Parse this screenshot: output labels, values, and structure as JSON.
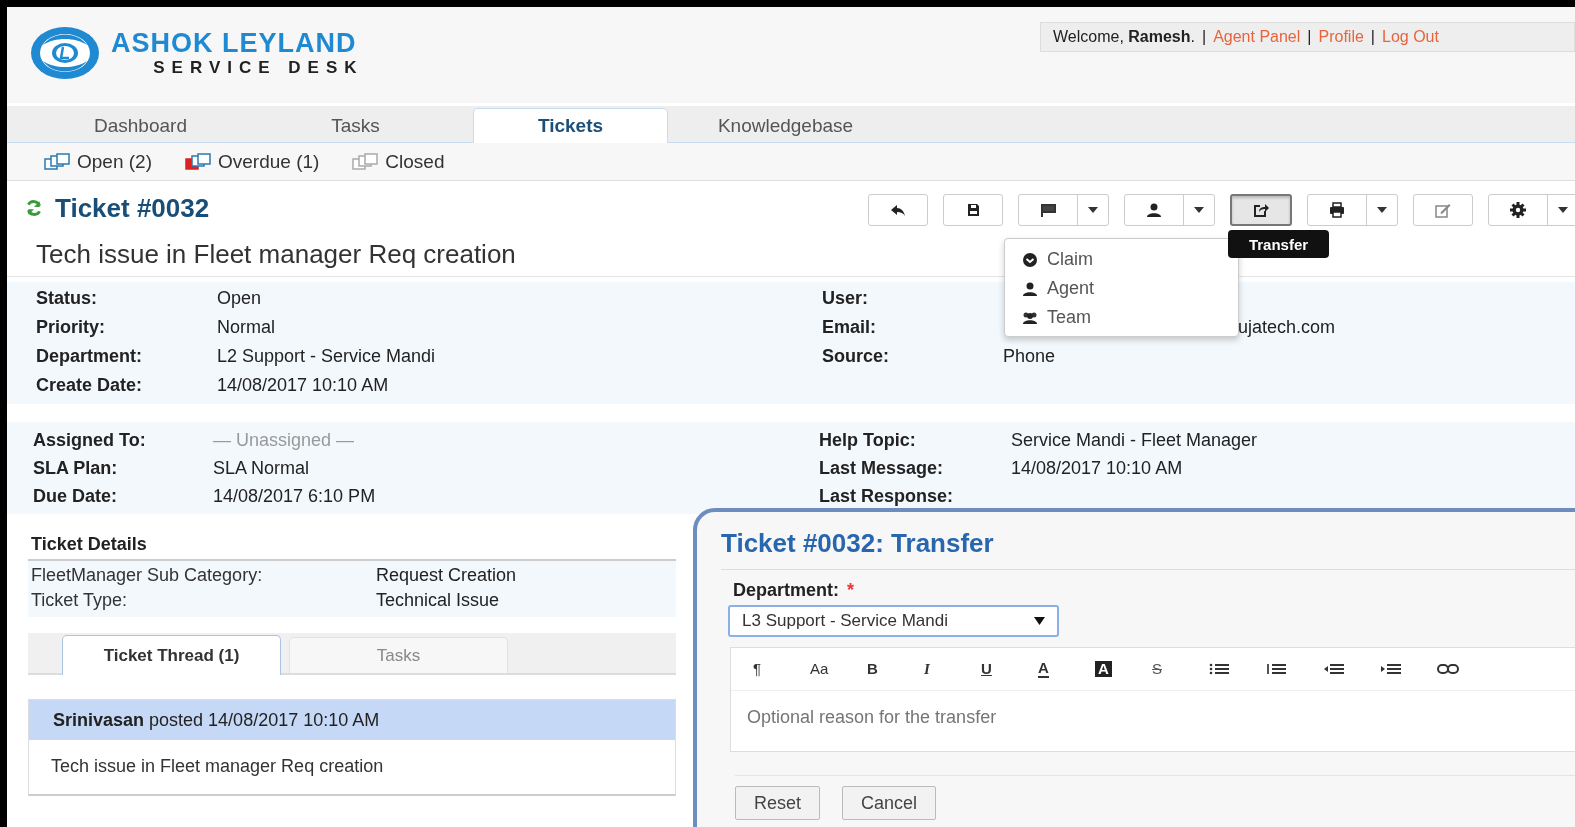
{
  "header": {
    "logo_name": "ASHOK LEYLAND",
    "logo_subtitle": "SERVICE DESK",
    "welcome": "Welcome, **Ramesh**.",
    "separator": "|",
    "links": [
      "Agent Panel",
      "Profile",
      "Log Out"
    ]
  },
  "nav_tabs": [
    {
      "label": "Dashboard",
      "selected": false
    },
    {
      "label": "Tasks",
      "selected": false
    },
    {
      "label": "Tickets",
      "selected": true
    },
    {
      "label": "Knowledgebase",
      "selected": false
    }
  ],
  "sub_nav": [
    {
      "label": "Open (2)",
      "kind": "open"
    },
    {
      "label": "Overdue (1)",
      "kind": "overdue"
    },
    {
      "label": "Closed",
      "kind": "closed"
    }
  ],
  "ticket": {
    "title": "Ticket #0032",
    "subject": "Tech issue in Fleet manager Req creation"
  },
  "toolbar": [
    {
      "kind": "reply",
      "dropdown": false,
      "pressed": false
    },
    {
      "kind": "save",
      "dropdown": false,
      "pressed": false
    },
    {
      "kind": "flag",
      "dropdown": true,
      "pressed": false
    },
    {
      "kind": "assign",
      "dropdown": true,
      "pressed": false
    },
    {
      "kind": "transfer",
      "dropdown": false,
      "pressed": true
    },
    {
      "kind": "print",
      "dropdown": true,
      "pressed": false
    },
    {
      "kind": "edit",
      "dropdown": false,
      "pressed": false
    },
    {
      "kind": "settings",
      "dropdown": true,
      "pressed": false
    }
  ],
  "tooltip": "Transfer",
  "assign_menu": [
    {
      "kind": "claim",
      "label": "Claim"
    },
    {
      "kind": "agent",
      "label": "Agent"
    },
    {
      "kind": "team",
      "label": "Team"
    }
  ],
  "info_left": [
    {
      "label": "Status:",
      "value": "Open",
      "muted": false
    },
    {
      "label": "Priority:",
      "value": "Normal",
      "muted": false
    },
    {
      "label": "Department:",
      "value": "L2 Support - Service Mandi",
      "muted": false
    },
    {
      "label": "Create Date:",
      "value": "14/08/2017 10:10 AM",
      "muted": false
    }
  ],
  "info_right": [
    {
      "label": "User:"
    },
    {
      "label": "Email:",
      "value": "ujatech.com"
    },
    {
      "label": "Source:",
      "value": "Phone"
    }
  ],
  "assign_left": [
    {
      "label": "Assigned To:",
      "value": "— Unassigned —",
      "muted": true
    },
    {
      "label": "SLA Plan:",
      "value": "SLA Normal",
      "muted": false
    },
    {
      "label": "Due Date:",
      "value": "14/08/2017 6:10 PM",
      "muted": false
    }
  ],
  "assign_right": [
    {
      "label": "Help Topic:",
      "value": "Service Mandi - Fleet Manager"
    },
    {
      "label": "Last Message:",
      "value": "14/08/2017 10:10 AM"
    },
    {
      "label": "Last Response:"
    }
  ],
  "details": {
    "title": "Ticket Details",
    "rows": [
      {
        "label": "FleetManager Sub Category:",
        "value": "Request Creation"
      },
      {
        "label": "Ticket Type:",
        "value": "Technical Issue"
      }
    ]
  },
  "thread_tabs": [
    {
      "label": "Ticket Thread (1)",
      "selected": true
    },
    {
      "label": "Tasks",
      "selected": false
    }
  ],
  "thread": [
    {
      "header": "**Srinivasan** posted 14/08/2017 10:10 AM",
      "body": "Tech issue in Fleet manager Req creation"
    }
  ],
  "dialog": {
    "title": "Ticket #0032: Transfer",
    "field_label": "Department:",
    "required": "*",
    "department": "L3 Support - Service Mandi",
    "editor_tools": [
      {
        "kind": "paragraph",
        "label": "¶"
      },
      {
        "kind": "font",
        "label": "Aa"
      },
      {
        "kind": "bold",
        "label": "B"
      },
      {
        "kind": "italic",
        "label": "I"
      },
      {
        "kind": "underline",
        "label": "U"
      },
      {
        "kind": "color",
        "label": "A"
      },
      {
        "kind": "highlight",
        "label": "A"
      },
      {
        "kind": "strike",
        "label": "S"
      },
      {
        "kind": "list-ul"
      },
      {
        "kind": "list-ol"
      },
      {
        "kind": "outdent"
      },
      {
        "kind": "indent"
      },
      {
        "kind": "link"
      }
    ],
    "placeholder": "Optional reason for the transfer",
    "buttons": [
      "Reset",
      "Cancel"
    ]
  }
}
